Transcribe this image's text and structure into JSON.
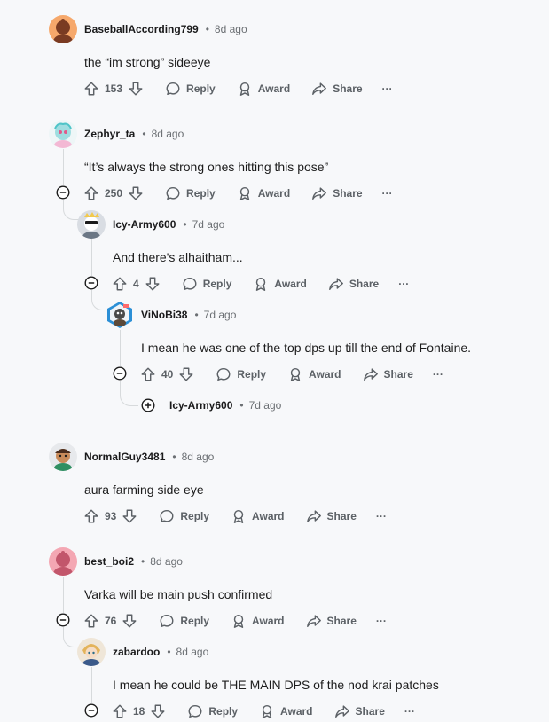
{
  "comments": [
    {
      "author": "BaseballAccording799",
      "time": "8d ago",
      "body": "the “im strong” sideeye",
      "votes": "153"
    },
    {
      "author": "Zephyr_ta",
      "time": "8d ago",
      "body": "“It’s always the strong ones hitting this pose”",
      "votes": "250"
    },
    {
      "author": "Icy-Army600",
      "time": "7d ago",
      "body": "And there's alhaitham...",
      "votes": "4"
    },
    {
      "author": "ViNoBi38",
      "time": "7d ago",
      "body": "I mean he was one of the top dps up till the end of Fontaine.",
      "votes": "40"
    },
    {
      "author": "Icy-Army600",
      "time": "7d ago"
    },
    {
      "author": "NormalGuy3481",
      "time": "8d ago",
      "body": "aura farming side eye",
      "votes": "93"
    },
    {
      "author": "best_boi2",
      "time": "8d ago",
      "body": "Varka will be main push confirmed",
      "votes": "76"
    },
    {
      "author": "zabardoo",
      "time": "8d ago",
      "body": "I mean he could be THE MAIN DPS of the nod krai patches",
      "votes": "18"
    }
  ],
  "labels": {
    "reply": "Reply",
    "award": "Award",
    "share": "Share",
    "more": "···",
    "dot": "•"
  },
  "colors": {
    "text": "#1c1c1c",
    "meta": "#6b6f73",
    "action": "#5c6166",
    "thread_line": "#d7dadc",
    "background": "#f7f8fa"
  }
}
